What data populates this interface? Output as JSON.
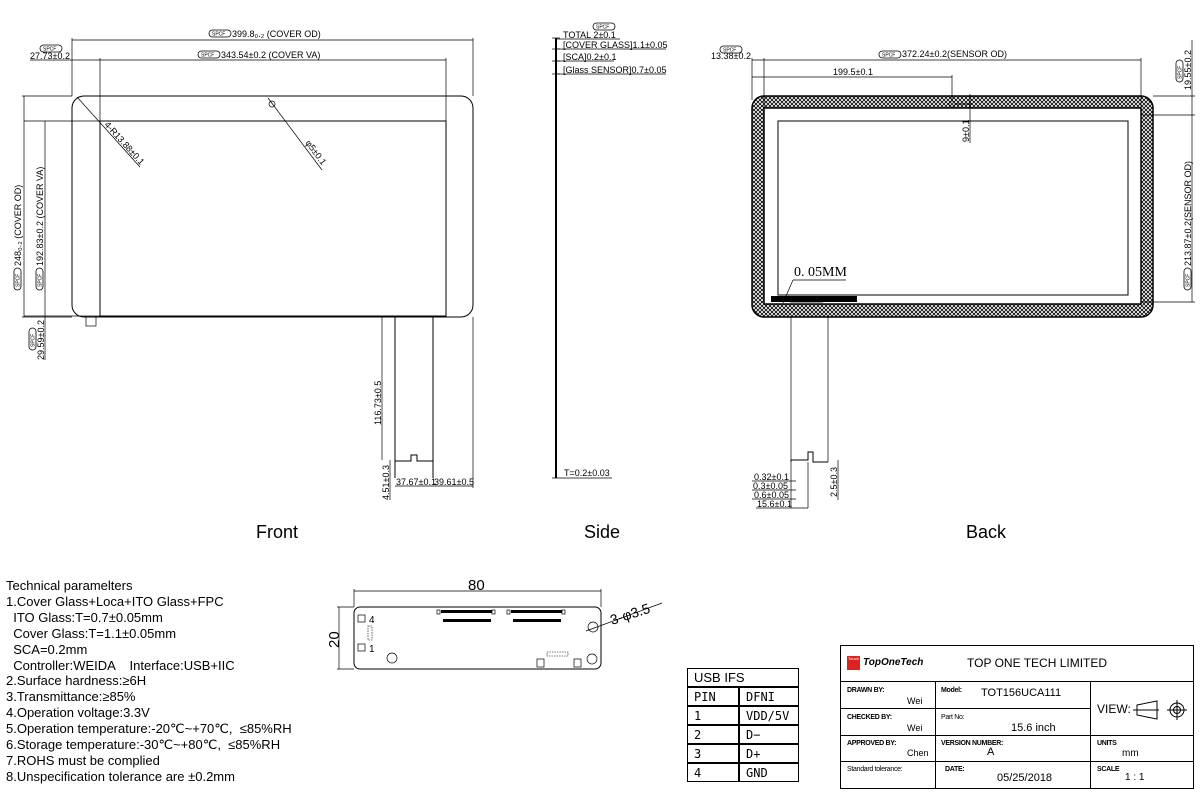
{
  "views": {
    "front": {
      "label": "Front",
      "dims": {
        "cover_od_width": "399.8₀.₂ (COVER OD)",
        "cover_va_width": "343.54±0.2 (COVER VA)",
        "left_offset": "27.73±0.2",
        "cover_od_height": "248₀.₂ (COVER OD)",
        "cover_va_height": "192.83±0.2 (COVER VA)",
        "bottom_offset": "29.59±0.2",
        "corner_radius": "4-R13.88±0.1",
        "hole": "φ5±0.1",
        "fpc_length": "116.73±0.5",
        "fpc_tail": "4.51±0.3",
        "fpc_width": "37.67±0.1",
        "fpc_right": "39.61±0.5"
      }
    },
    "side": {
      "label": "Side",
      "dims": {
        "total": "TOTAL 2±0.1",
        "cover_glass": "[COVER GLASS]1.1±0.05",
        "sca": "[SCA]0.2±0.1",
        "glass_sensor": "[Glass SENSOR]0.7±0.05",
        "fpc_thickness": "T=0.2±0.03"
      }
    },
    "back": {
      "label": "Back",
      "dims": {
        "sensor_od_width": "372.24±0.2(SENSOR OD)",
        "left_offset": "13.38±0.2",
        "hole_pos": "199.5±0.1",
        "hole_depth": "9±0.1",
        "top_offset": "19.55±0.2",
        "sensor_od_height": "213.87±0.2(SENSOR OD)",
        "gap": "0. 05MM",
        "fpc_a": "0.32±0.1",
        "fpc_b": "0.3±0.05",
        "fpc_c": "0.6±0.05",
        "fpc_d": "15.6±0.1",
        "fpc_e": "2.5±0.3"
      }
    },
    "spec_tag": "SPCF"
  },
  "controller_board": {
    "width": "80",
    "height": "20",
    "holes": "3-φ3.5",
    "pin_first": "1",
    "pin_last": "4"
  },
  "technical": {
    "title": "Technical paramelters",
    "lines": [
      "1.Cover Glass+Loca+ITO Glass+FPC",
      "  ITO Glass:T=0.7±0.05mm",
      "  Cover Glass:T=1.1±0.05mm",
      "  SCA=0.2mm",
      "  Controller:WEIDA    Interface:USB+IIC",
      "2.Surface hardness:≥6H",
      "3.Transmittance:≥85%",
      "4.Operation voltage:3.3V",
      "5.Operation temperature:-20℃~+70℃,  ≤85%RH",
      "6.Storage temperature:-30℃~+80℃,  ≤85%RH",
      "7.ROHS must be complied",
      "8.Unspecification tolerance are ±0.2mm"
    ]
  },
  "usb_table": {
    "title": "USB IFS",
    "headers": [
      "PIN",
      "DFNI"
    ],
    "rows": [
      [
        "1",
        "VDD/5V"
      ],
      [
        "2",
        "D−"
      ],
      [
        "3",
        "D+"
      ],
      [
        "4",
        "GND"
      ]
    ]
  },
  "title_block": {
    "logo_text": "TopOneTech",
    "logo_badge": "Touch",
    "company": "TOP ONE TECH LIMITED",
    "drawn_by_label": "DRAWN BY:",
    "drawn_by": "Wei",
    "checked_by_label": "CHECKED BY:",
    "checked_by": "Wei",
    "approved_by_label": "APPROVED BY:",
    "approved_by": "Chen",
    "tolerance_label": "Standard tolerance:",
    "model_label": "Model:",
    "model": "TOT156UCA111",
    "part_label": "Part No:",
    "part": "15.6 inch",
    "version_label": "VERSION NUMBER:",
    "version": "A",
    "date_label": "DATE:",
    "date": "05/25/2018",
    "view_label": "VIEW:",
    "units_label": "UNITS",
    "units": "mm",
    "scale_label": "SCALE",
    "scale": "1 : 1"
  }
}
